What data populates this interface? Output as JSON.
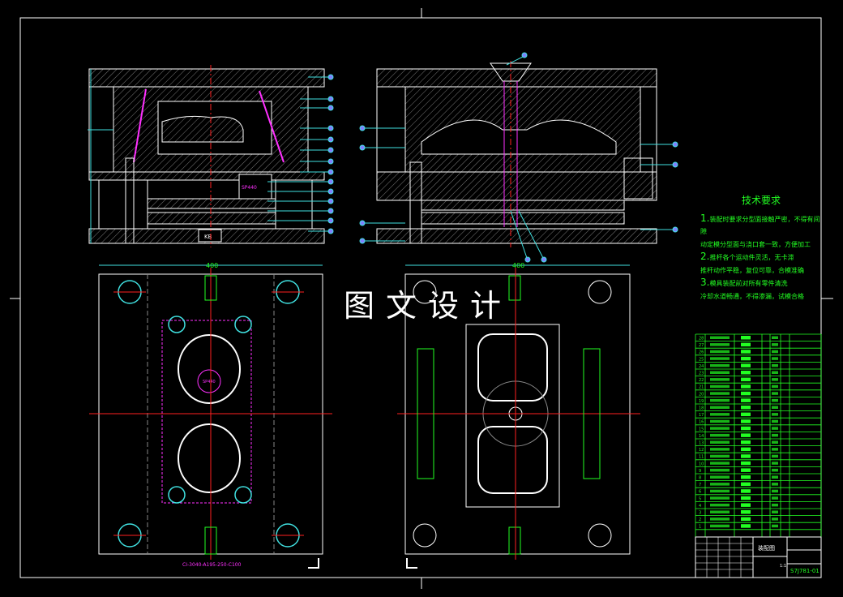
{
  "watermark": "图文设计",
  "tech_requirements": {
    "title": "技术要求",
    "items": [
      {
        "num": "1.",
        "text": "装配时要求分型面接触严密，不得有间隙",
        "cont": "动定模分型面与浇口套一致，方便加工"
      },
      {
        "num": "2.",
        "text": "推杆各个运动件灵活，无卡滞",
        "cont": "推杆动作平稳，复位可靠，合模准确"
      },
      {
        "num": "3.",
        "text": "模具装配前对所有零件清洗",
        "cont": "冷却水道畅通，不得渗漏，试模合格"
      }
    ]
  },
  "labels": {
    "plate_label": "SP440",
    "plate_label_2": "SP440",
    "width_dim": "400",
    "width_dim_2": "400",
    "mold_base_code": "CI-3040-A195-250-C100",
    "kb_label": "KB"
  },
  "title_block": {
    "drawing_no": "S7J781-01",
    "name": "装配图",
    "scale": "1:1"
  },
  "bom_rows": [
    "28",
    "27",
    "26",
    "25",
    "24",
    "23",
    "22",
    "21",
    "20",
    "19",
    "18",
    "17",
    "16",
    "15",
    "14",
    "13",
    "12",
    "11",
    "10",
    "9",
    "8",
    "7",
    "6",
    "5",
    "4",
    "3",
    "2",
    "1"
  ],
  "colors": {
    "outline": "#ffffff",
    "hatch": "#b0b0b0",
    "center": "#ff2020",
    "dimension": "#40e0e0",
    "text": "#20ff20",
    "balloon": "#8080ff",
    "magenta": "#ff30ff",
    "yellow": "#ffff40"
  }
}
